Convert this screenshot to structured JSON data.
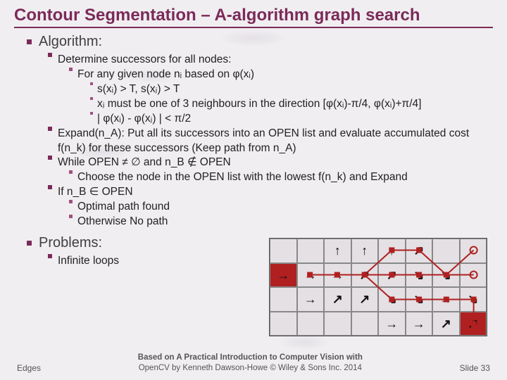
{
  "title": "Contour Segmentation – A-algorithm graph search",
  "sections": {
    "algorithm": {
      "header": "Algorithm:",
      "items": {
        "determine": "Determine successors for all nodes:",
        "forany": "For any given node nᵢ based on φ(xᵢ)",
        "sxi": "s(xᵢ) > T, s(xⱼ) > T",
        "xj": "xⱼ must be one of 3 neighbours in the direction [φ(xᵢ)-π/4, φ(xᵢ)+π/4]",
        "abs": "| φ(xᵢ) - φ(xⱼ) | < π/2",
        "expand": "Expand(n_A):  Put all its successors into an OPEN list and evaluate accumulated cost f(n_k) for these successors (Keep path from n_A)",
        "while": "While  OPEN ≠ ∅  and  n_B ∉ OPEN",
        "choose": "Choose the node in the OPEN list with the lowest f(n_k) and Expand",
        "ifnb": "If n_B ∈ OPEN",
        "optimal": "Optimal path found",
        "otherwise": "Otherwise No path"
      }
    },
    "problems": {
      "header": "Problems:",
      "items": {
        "loops": "Infinite loops"
      }
    }
  },
  "diagram": {
    "cells": [
      {
        "r": 0,
        "c": 0,
        "arr": ""
      },
      {
        "r": 0,
        "c": 1,
        "arr": ""
      },
      {
        "r": 0,
        "c": 2,
        "arr": "↑"
      },
      {
        "r": 0,
        "c": 3,
        "arr": "↑"
      },
      {
        "r": 0,
        "c": 4,
        "arr": "↑"
      },
      {
        "r": 0,
        "c": 5,
        "arr": "↗"
      },
      {
        "r": 0,
        "c": 6,
        "arr": ""
      },
      {
        "r": 0,
        "c": 7,
        "arr": ""
      },
      {
        "r": 1,
        "c": 0,
        "arr": "→",
        "hl": true
      },
      {
        "r": 1,
        "c": 1,
        "arr": "→"
      },
      {
        "r": 1,
        "c": 2,
        "arr": "→"
      },
      {
        "r": 1,
        "c": 3,
        "arr": "↗"
      },
      {
        "r": 1,
        "c": 4,
        "arr": "↗"
      },
      {
        "r": 1,
        "c": 5,
        "arr": "↘"
      },
      {
        "r": 1,
        "c": 6,
        "arr": "↘"
      },
      {
        "r": 1,
        "c": 7,
        "arr": ""
      },
      {
        "r": 2,
        "c": 0,
        "arr": ""
      },
      {
        "r": 2,
        "c": 1,
        "arr": "→"
      },
      {
        "r": 2,
        "c": 2,
        "arr": "↗"
      },
      {
        "r": 2,
        "c": 3,
        "arr": "↗"
      },
      {
        "r": 2,
        "c": 4,
        "arr": "↘"
      },
      {
        "r": 2,
        "c": 5,
        "arr": "↘"
      },
      {
        "r": 2,
        "c": 6,
        "arr": "→"
      },
      {
        "r": 2,
        "c": 7,
        "arr": "↘"
      },
      {
        "r": 3,
        "c": 0,
        "arr": ""
      },
      {
        "r": 3,
        "c": 1,
        "arr": ""
      },
      {
        "r": 3,
        "c": 2,
        "arr": ""
      },
      {
        "r": 3,
        "c": 3,
        "arr": ""
      },
      {
        "r": 3,
        "c": 4,
        "arr": "→"
      },
      {
        "r": 3,
        "c": 5,
        "arr": "→"
      },
      {
        "r": 3,
        "c": 6,
        "arr": "↗"
      },
      {
        "r": 3,
        "c": 7,
        "arr": "↗",
        "hl": true
      }
    ],
    "nodes": [
      {
        "r": 1,
        "c": 1
      },
      {
        "r": 1,
        "c": 2
      },
      {
        "r": 1,
        "c": 3
      },
      {
        "r": 0,
        "c": 4
      },
      {
        "r": 0,
        "c": 5
      },
      {
        "r": 1,
        "c": 4
      },
      {
        "r": 1,
        "c": 5
      },
      {
        "r": 2,
        "c": 4
      },
      {
        "r": 2,
        "c": 5
      },
      {
        "r": 2,
        "c": 6
      },
      {
        "r": 1,
        "c": 6
      },
      {
        "r": 2,
        "c": 7
      },
      {
        "r": 3,
        "c": 7
      },
      {
        "r": 0,
        "c": 7,
        "open": true
      },
      {
        "r": 1,
        "c": 7,
        "open": true
      }
    ],
    "edges": [
      [
        1,
        1,
        1,
        2
      ],
      [
        1,
        2,
        1,
        3
      ],
      [
        1,
        3,
        0,
        4
      ],
      [
        0,
        4,
        0,
        5
      ],
      [
        1,
        3,
        1,
        4
      ],
      [
        1,
        4,
        1,
        5
      ],
      [
        1,
        3,
        2,
        4
      ],
      [
        2,
        4,
        2,
        5
      ],
      [
        0,
        5,
        1,
        6
      ],
      [
        1,
        5,
        1,
        6
      ],
      [
        2,
        5,
        2,
        6
      ],
      [
        2,
        6,
        2,
        7
      ],
      [
        1,
        6,
        0,
        7
      ],
      [
        1,
        6,
        1,
        7
      ],
      [
        2,
        7,
        3,
        7
      ]
    ]
  },
  "footer": {
    "left": "Edges",
    "center1": "Based on  A Practical Introduction to Computer Vision with",
    "center2": "OpenCV  by Kenneth Dawson-Howe © Wiley & Sons Inc. 2014",
    "right": "Slide 33"
  }
}
